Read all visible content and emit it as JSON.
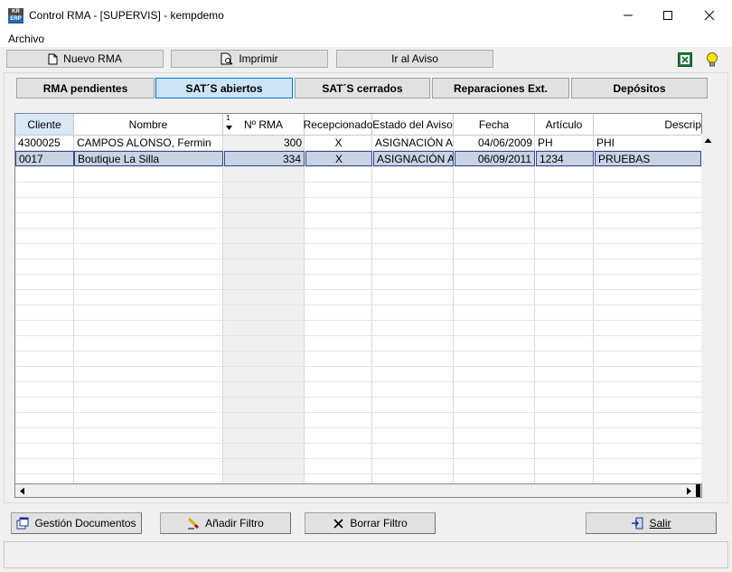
{
  "window": {
    "title": "Control RMA - [SUPERVIS] - kempdemo",
    "icon_top": "KR",
    "icon_bottom": "ERP",
    "minimize_label": "—",
    "maximize_label": "☐",
    "close_label": "✕"
  },
  "menu": {
    "archivo": "Archivo"
  },
  "toolbar": {
    "nuevo_rma": "Nuevo RMA",
    "imprimir": "Imprimir",
    "ir_aviso": "Ir al Aviso",
    "excel_icon": "excel-icon",
    "bulb_icon": "lightbulb-icon"
  },
  "tabs": [
    {
      "label": "RMA pendientes",
      "active": false
    },
    {
      "label": "SAT´S abiertos",
      "active": true
    },
    {
      "label": "SAT´S cerrados",
      "active": false
    },
    {
      "label": "Reparaciones Ext.",
      "active": false
    },
    {
      "label": "Depósitos",
      "active": false
    }
  ],
  "grid": {
    "sort_indicator": "1",
    "columns": [
      "Cliente",
      "Nombre",
      "Nº RMA",
      "Recepcionado",
      "Estado del Aviso",
      "Fecha",
      "Artículo",
      "Descrip"
    ],
    "rows": [
      {
        "cliente": "4300025",
        "nombre": "CAMPOS ALONSO, Fermin",
        "rma": "300",
        "recepcionado": "X",
        "estado": "ASIGNACIÓN ABI",
        "fecha": "04/06/2009",
        "articulo": "PH",
        "descrip": "PHI",
        "selected": false
      },
      {
        "cliente": "0017",
        "nombre": "Boutique La Silla",
        "rma": "334",
        "recepcionado": "X",
        "estado": "ASIGNACIÓN ABI",
        "fecha": "06/09/2011",
        "articulo": "1234",
        "descrip": "PRUEBAS",
        "selected": true
      }
    ]
  },
  "bottom": {
    "gestion": "Gestión Documentos",
    "anadir": "Añadir Filtro",
    "borrar": "Borrar Filtro",
    "salir": "Salir"
  }
}
